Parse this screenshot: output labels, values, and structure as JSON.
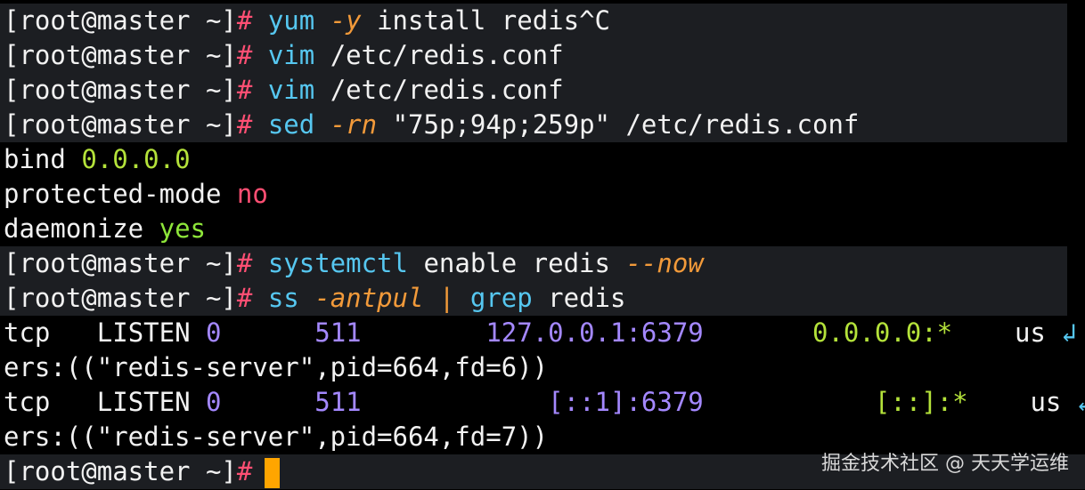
{
  "prompt": "[root@master ~]",
  "hash": "#",
  "lines": [
    {
      "cmd": "yum",
      "flag": "-y",
      "rest": "install redis^C"
    },
    {
      "cmd": "vim",
      "rest": "/etc/redis.conf"
    },
    {
      "cmd": "vim",
      "rest": "/etc/redis.conf"
    },
    {
      "cmd": "sed",
      "flag": "-rn",
      "str": "\"75p;94p;259p\"",
      "rest": "/etc/redis.conf"
    }
  ],
  "config_output": [
    {
      "key": "bind",
      "value": "0.0.0.0"
    },
    {
      "key": "protected-mode",
      "value": "no"
    },
    {
      "key": "daemonize",
      "value": "yes"
    }
  ],
  "systemctl": {
    "cmd": "systemctl",
    "args": "enable redis",
    "flag": "--now"
  },
  "ss": {
    "cmd": "ss",
    "flag": "-antpul",
    "pipe": "|",
    "grep": "grep",
    "grep_arg": "redis"
  },
  "sockets": [
    {
      "proto": "tcp",
      "state": "LISTEN",
      "recvq": "0",
      "sendq": "511",
      "local": "127.0.0.1:6379",
      "peer": "0.0.0.0:*",
      "us": "us",
      "wrap": "ers:((\"redis-server\",pid=664,fd=6))",
      "pid": "664",
      "fd": "6"
    },
    {
      "proto": "tcp",
      "state": "LISTEN",
      "recvq": "0",
      "sendq": "511",
      "local": "[::1]:6379",
      "peer": "[::]:*",
      "us": "us",
      "wrap": "ers:((\"redis-server\",pid=664,fd=7))",
      "pid": "664",
      "fd": "7"
    }
  ],
  "wrap_marker": "↲",
  "watermark": "掘金技术社区 @ 天天学运维",
  "colors": {
    "background": "#000000",
    "prompt_bg": "#1c1e22",
    "hash": "#ff4f73",
    "command": "#56c7f0",
    "flag": "#f29a3a",
    "number": "#b4e23a",
    "purple": "#a488ff",
    "cursor": "#ffa500"
  }
}
